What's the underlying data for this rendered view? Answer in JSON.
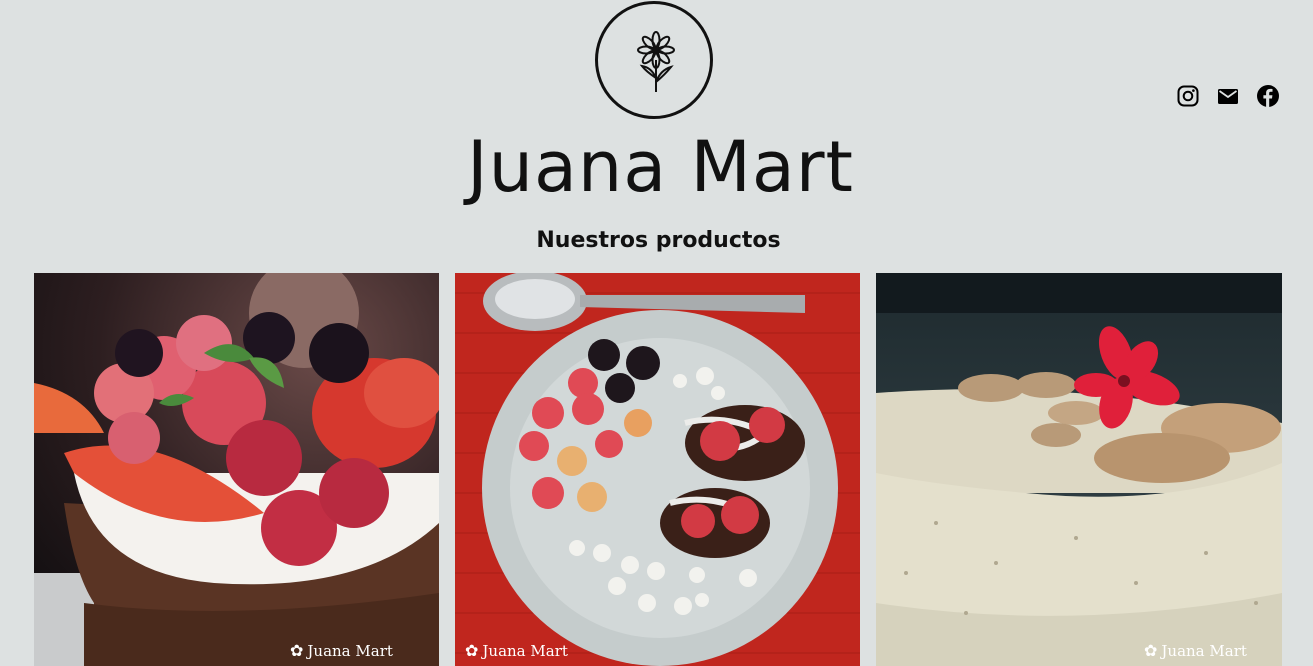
{
  "header": {
    "brand_name": "Juana Mart",
    "logo_icon": "flower-icon",
    "social": [
      {
        "name": "instagram-icon",
        "label": "Instagram"
      },
      {
        "name": "email-icon",
        "label": "Email"
      },
      {
        "name": "facebook-icon",
        "label": "Facebook"
      }
    ]
  },
  "products_section": {
    "title": "Nuestros productos",
    "items": [
      {
        "image": "berry-chocolate-cake-photo",
        "watermark": "Juana Mart"
      },
      {
        "image": "chocolate-bites-berries-plate-photo",
        "watermark": "Juana Mart"
      },
      {
        "image": "cheesecake-almond-cookies-photo",
        "watermark": "Juana Mart"
      }
    ]
  },
  "colors": {
    "background": "#dde1e1",
    "text": "#111111"
  }
}
